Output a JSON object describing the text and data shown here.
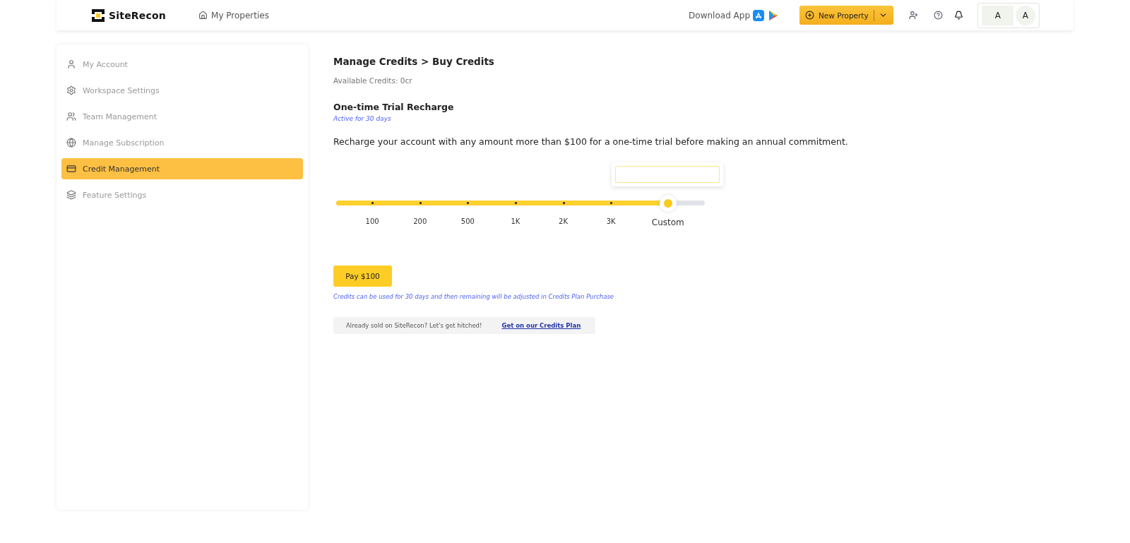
{
  "header": {
    "logo": "SiteRecon",
    "nav": "My Properties",
    "download": "Download App",
    "new_property": "New Property",
    "avatars": [
      "A",
      "A"
    ]
  },
  "sidebar": {
    "items": [
      {
        "label": "My Account",
        "kind": "user",
        "selected": false
      },
      {
        "label": "Workspace Settings",
        "kind": "gear",
        "selected": false
      },
      {
        "label": "Team Management",
        "kind": "team",
        "selected": false
      },
      {
        "label": "Manage Subscription",
        "kind": "subscription",
        "selected": false
      },
      {
        "label": "Credit Management",
        "kind": "card",
        "selected": true
      },
      {
        "label": "Feature Settings",
        "kind": "layers",
        "selected": false
      }
    ]
  },
  "main": {
    "breadcrumb": "Manage Credits > Buy Credits",
    "available": "Available Credits: 0cr",
    "section_title": "One-time Trial Recharge",
    "active_note": "Active for 30 days",
    "description": "Recharge your account with any amount more than $100 for a one-time trial before making an annual commitment.",
    "slider": {
      "level": 0.9,
      "marks": [
        {
          "label": "100",
          "selected": false
        },
        {
          "label": "200",
          "selected": false
        },
        {
          "label": "500",
          "selected": false
        },
        {
          "label": "1K",
          "selected": false
        },
        {
          "label": "2K",
          "selected": false
        },
        {
          "label": "3K",
          "selected": false
        },
        {
          "label": "Custom",
          "selected": true
        }
      ]
    },
    "pay_button": "Pay $100",
    "pay_note": "Credits can be used for 30 days and then remaining will be adjusted in Credits Plan Purchase",
    "banner": {
      "text": "Already sold on SiteRecon? Let's get hitched!",
      "link": "Get on our Credits Plan"
    }
  }
}
